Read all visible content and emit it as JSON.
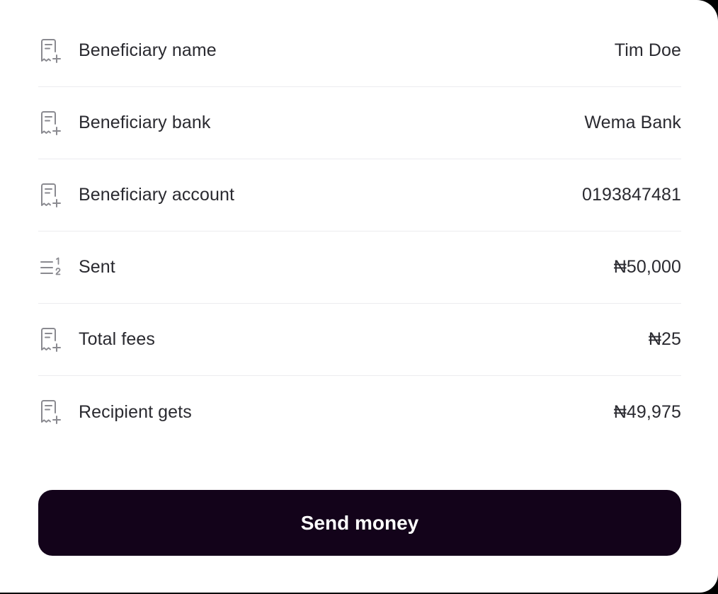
{
  "rows": [
    {
      "icon": "receipt-add-icon",
      "label": "Beneficiary name",
      "value": "Tim Doe"
    },
    {
      "icon": "receipt-add-icon",
      "label": "Beneficiary bank",
      "value": "Wema Bank"
    },
    {
      "icon": "receipt-add-icon",
      "label": "Beneficiary account",
      "value": "0193847481"
    },
    {
      "icon": "list-ordered-icon",
      "label": "Sent",
      "value": "₦50,000"
    },
    {
      "icon": "receipt-add-icon",
      "label": "Total fees",
      "value": "₦25"
    },
    {
      "icon": "receipt-add-icon",
      "label": "Recipient gets",
      "value": "₦49,975"
    }
  ],
  "actions": {
    "send_label": "Send money"
  },
  "colors": {
    "button_bg": "#13031a",
    "icon_stroke": "#8a8a90",
    "divider": "#ececef"
  }
}
